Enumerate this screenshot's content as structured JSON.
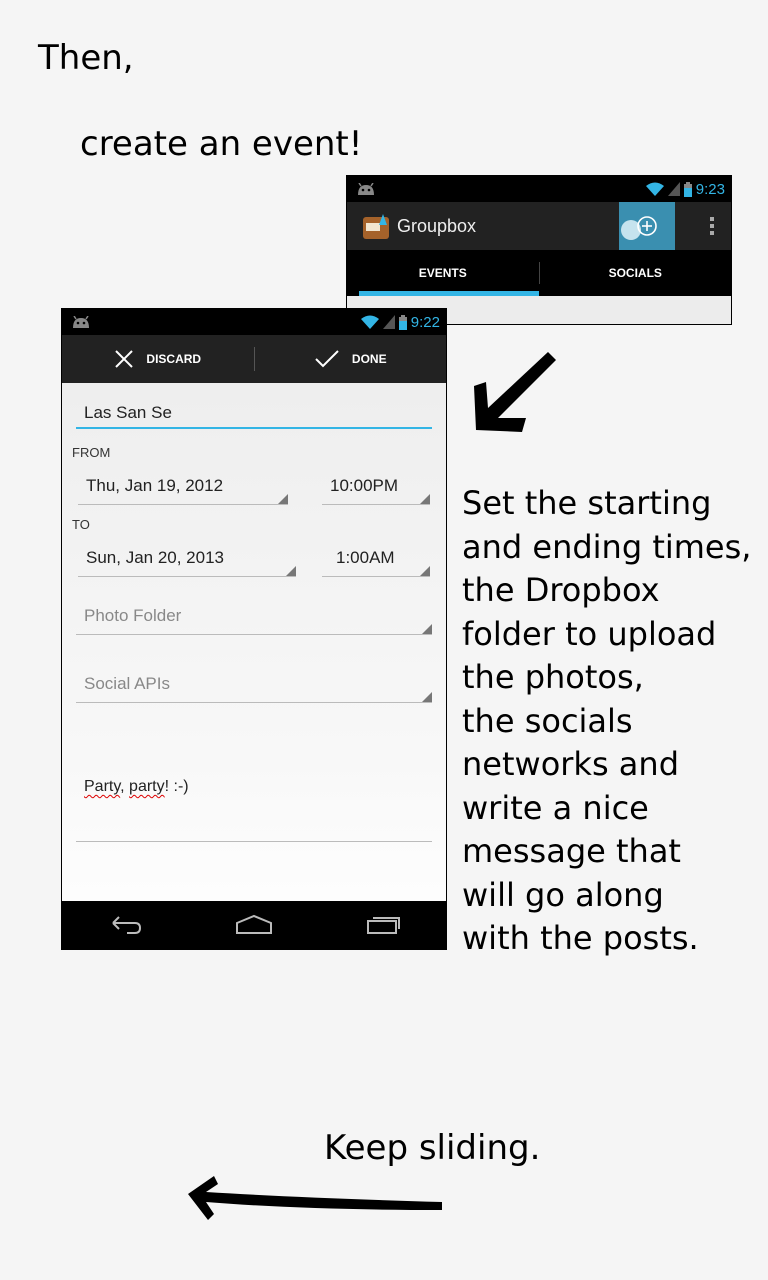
{
  "slide": {
    "heading_then": "Then,",
    "heading_create": "create an event!",
    "instructions": [
      "Set the starting",
      "and ending times,",
      "the Dropbox",
      "folder to upload",
      "the photos,",
      "the socials",
      "networks and",
      "write a nice",
      "message that",
      "will go along",
      "with the posts."
    ],
    "footer": "Keep sliding."
  },
  "groupbox_screen": {
    "status_time": "9:23",
    "app_title": "Groupbox",
    "tabs": [
      "EVENTS",
      "SOCIALS"
    ],
    "active_tab": "EVENTS"
  },
  "editor_screen": {
    "status_time": "9:22",
    "discard_label": "DISCARD",
    "done_label": "DONE",
    "event_name": "Las San Se",
    "from_label": "FROM",
    "from_date": "Thu, Jan 19, 2012",
    "from_time": "10:00PM",
    "to_label": "TO",
    "to_date": "Sun, Jan 20, 2013",
    "to_time": "1:00AM",
    "photo_folder_hint": "Photo Folder",
    "social_apis_hint": "Social APIs",
    "message_word1": "Party",
    "message_sep": ", ",
    "message_word2": "party",
    "message_rest": "! :-)"
  },
  "colors": {
    "holo_blue": "#33b5e5",
    "action_bar": "#222222",
    "background": "#f5f5f5"
  },
  "icons": [
    "android-icon",
    "wifi-icon",
    "signal-icon",
    "battery-icon",
    "groupbox-app-icon",
    "add-icon",
    "overflow-icon",
    "discard-x-icon",
    "done-check-icon",
    "back-icon",
    "home-icon",
    "recents-icon",
    "arrow-down-left-icon",
    "arrow-left-icon"
  ]
}
